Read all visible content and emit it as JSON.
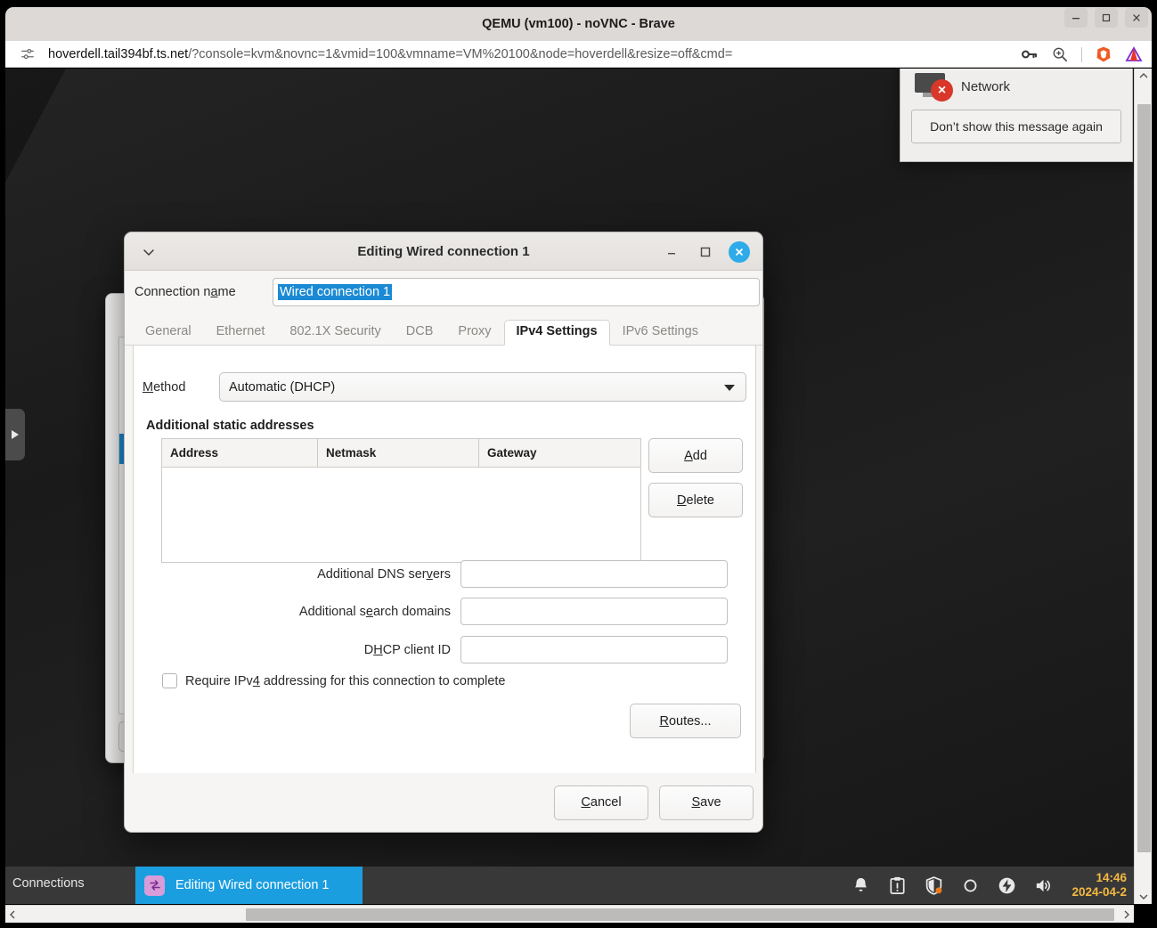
{
  "browser": {
    "title": "QEMU (vm100) - noVNC - Brave",
    "window_controls": {
      "minimize": "minimize-icon",
      "maximize": "maximize-icon",
      "close": "close-icon"
    },
    "url_host": "hoverdell.tail394bf.ts.net",
    "url_path": "/?console=kvm&novnc=1&vmid=100&vmname=VM%20100&node=hoverdell&resize=off&cmd=",
    "toolbar_icons": [
      "tune-icon",
      "key-icon",
      "zoom-icon",
      "brave-lion-icon",
      "brave-rewards-triangle-icon"
    ]
  },
  "notification": {
    "title": "Network",
    "icon": "network-error-icon",
    "badge": "×",
    "dismiss_label": "Don’t show this message again"
  },
  "dialog": {
    "title": "Editing Wired connection 1",
    "menu_icon": "chevron-down-icon",
    "connection_name_label": "Connection name",
    "connection_name_value": "Wired connection 1",
    "tabs": [
      {
        "label": "General",
        "active": false
      },
      {
        "label": "Ethernet",
        "active": false
      },
      {
        "label": "802.1X Security",
        "active": false
      },
      {
        "label": "DCB",
        "active": false
      },
      {
        "label": "Proxy",
        "active": false
      },
      {
        "label": "IPv4 Settings",
        "active": true
      },
      {
        "label": "IPv6 Settings",
        "active": false
      }
    ],
    "method_label": "Method",
    "method_value": "Automatic (DHCP)",
    "method_options": [
      "Automatic (DHCP)"
    ],
    "static_addresses_heading": "Additional static addresses",
    "address_table": {
      "columns": [
        "Address",
        "Netmask",
        "Gateway"
      ],
      "rows": []
    },
    "add_label": "Add",
    "delete_label": "Delete",
    "fields": [
      {
        "label": "Additional DNS servers",
        "value": "",
        "placeholder": ""
      },
      {
        "label": "Additional search domains",
        "value": "",
        "placeholder": ""
      },
      {
        "label": "DHCP client ID",
        "value": "",
        "placeholder": ""
      }
    ],
    "require_ipv4_label": "Require IPv4 addressing for this connection to complete",
    "require_ipv4_checked": false,
    "routes_label": "Routes...",
    "cancel_label": "Cancel",
    "save_label": "Save"
  },
  "taskbar": {
    "previous_window_label": "Connections",
    "active_window_label": "Editing Wired connection 1",
    "active_window_icon": "network-connections-icon",
    "tray_icons": [
      "bell-icon",
      "clipboard-alert-icon",
      "shield-icon",
      "circle-icon",
      "power-icon",
      "volume-icon"
    ],
    "clock_time": "14:46",
    "clock_date": "2024-04-2"
  },
  "colors": {
    "accent_blue": "#1b8ad4",
    "taskbar_active_blue": "#1b9ee0",
    "error_red": "#d8372a",
    "clock_amber": "#f5b942",
    "dialog_close_blue": "#2eabe8"
  }
}
